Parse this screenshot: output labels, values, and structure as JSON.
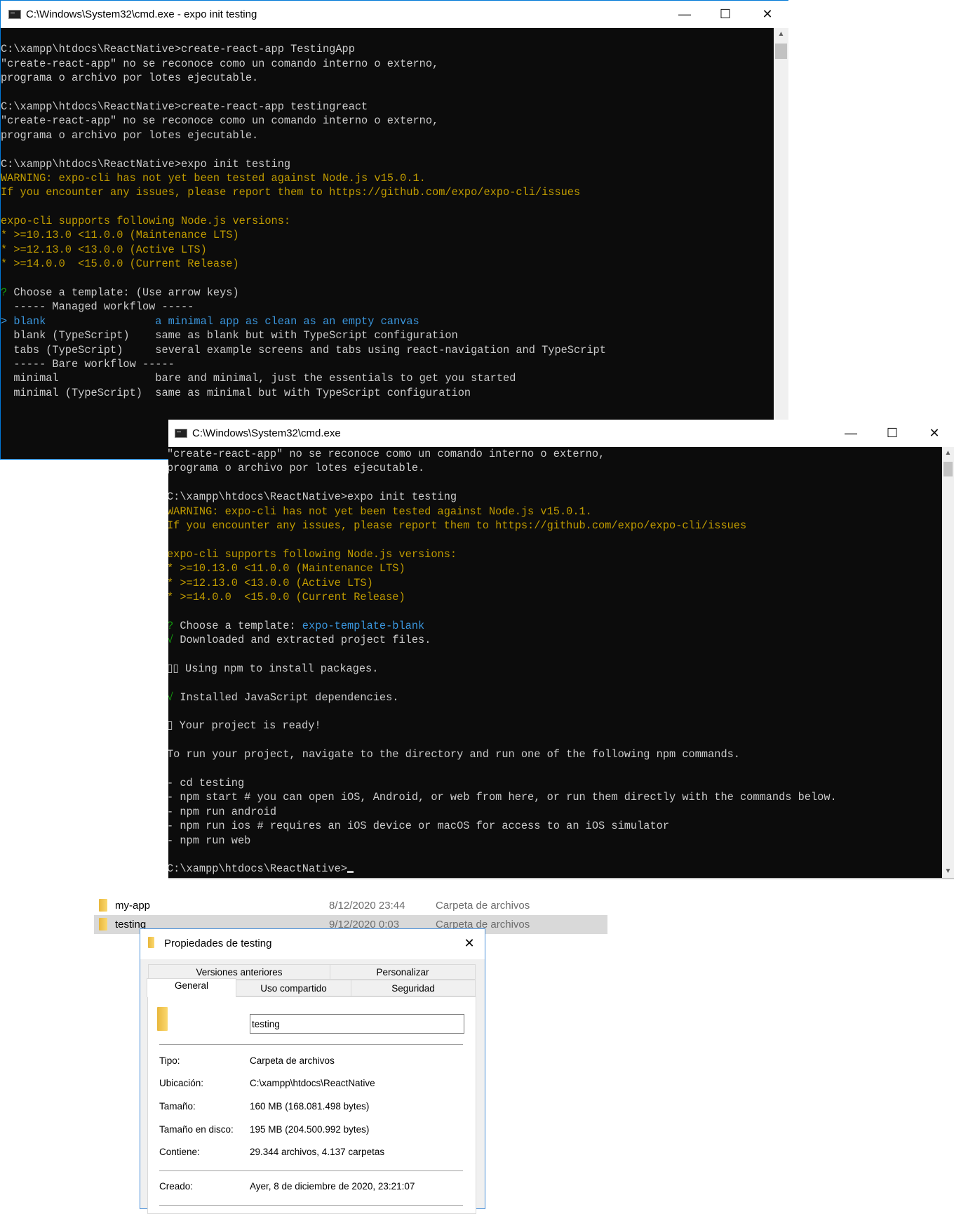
{
  "colors": {
    "default": "#cccccc",
    "yellow": "#c19c00",
    "blue": "#3a96dd",
    "green": "#13a10e",
    "background": "#0c0c0c"
  },
  "terminal1": {
    "title": "C:\\Windows\\System32\\cmd.exe - expo  init testing",
    "icon": "cmd-icon",
    "lines": [
      [],
      [
        {
          "t": "C:\\xampp\\htdocs\\ReactNative>create-react-app TestingApp",
          "c": "default"
        }
      ],
      [
        {
          "t": "\"create-react-app\" no se reconoce como un comando interno o externo,",
          "c": "default"
        }
      ],
      [
        {
          "t": "programa o archivo por lotes ejecutable.",
          "c": "default"
        }
      ],
      [],
      [
        {
          "t": "C:\\xampp\\htdocs\\ReactNative>create-react-app testingreact",
          "c": "default"
        }
      ],
      [
        {
          "t": "\"create-react-app\" no se reconoce como un comando interno o externo,",
          "c": "default"
        }
      ],
      [
        {
          "t": "programa o archivo por lotes ejecutable.",
          "c": "default"
        }
      ],
      [],
      [
        {
          "t": "C:\\xampp\\htdocs\\ReactNative>expo init testing",
          "c": "default"
        }
      ],
      [
        {
          "t": "WARNING: expo-cli has not yet been tested against Node.js v15.0.1.",
          "c": "yellow"
        }
      ],
      [
        {
          "t": "If you encounter any issues, please report them to https://github.com/expo/expo-cli/issues",
          "c": "yellow"
        }
      ],
      [],
      [
        {
          "t": "expo-cli supports following Node.js versions:",
          "c": "yellow"
        }
      ],
      [
        {
          "t": "* >=10.13.0 <11.0.0 (Maintenance LTS)",
          "c": "yellow"
        }
      ],
      [
        {
          "t": "* >=12.13.0 <13.0.0 (Active LTS)",
          "c": "yellow"
        }
      ],
      [
        {
          "t": "* >=14.0.0  <15.0.0 (Current Release)",
          "c": "yellow"
        }
      ],
      [],
      [
        {
          "t": "?",
          "c": "green"
        },
        {
          "t": " Choose a template: (Use arrow keys)",
          "c": "default"
        }
      ],
      [
        {
          "t": "  ----- Managed workflow -----",
          "c": "default"
        }
      ],
      [
        {
          "t": "> blank                 a minimal app as clean as an empty canvas",
          "c": "blue"
        }
      ],
      [
        {
          "t": "  blank (TypeScript)    same as blank but with TypeScript configuration",
          "c": "default"
        }
      ],
      [
        {
          "t": "  tabs (TypeScript)     several example screens and tabs using react-navigation and TypeScript",
          "c": "default"
        }
      ],
      [
        {
          "t": "  ----- Bare workflow -----",
          "c": "default"
        }
      ],
      [
        {
          "t": "  minimal               bare and minimal, just the essentials to get you started",
          "c": "default"
        }
      ],
      [
        {
          "t": "  minimal (TypeScript)  same as minimal but with TypeScript configuration",
          "c": "default"
        }
      ]
    ]
  },
  "terminal2": {
    "title": "C:\\Windows\\System32\\cmd.exe",
    "icon": "cmd-icon",
    "lines": [
      [
        {
          "t": "\"create-react-app\" no se reconoce como un comando interno o externo,",
          "c": "default"
        }
      ],
      [
        {
          "t": "programa o archivo por lotes ejecutable.",
          "c": "default"
        }
      ],
      [],
      [
        {
          "t": "C:\\xampp\\htdocs\\ReactNative>expo init testing",
          "c": "default"
        }
      ],
      [
        {
          "t": "WARNING: expo-cli has not yet been tested against Node.js v15.0.1.",
          "c": "yellow"
        }
      ],
      [
        {
          "t": "If you encounter any issues, please report them to https://github.com/expo/expo-cli/issues",
          "c": "yellow"
        }
      ],
      [],
      [
        {
          "t": "expo-cli supports following Node.js versions:",
          "c": "yellow"
        }
      ],
      [
        {
          "t": "* >=10.13.0 <11.0.0 (Maintenance LTS)",
          "c": "yellow"
        }
      ],
      [
        {
          "t": "* >=12.13.0 <13.0.0 (Active LTS)",
          "c": "yellow"
        }
      ],
      [
        {
          "t": "* >=14.0.0  <15.0.0 (Current Release)",
          "c": "yellow"
        }
      ],
      [],
      [
        {
          "t": "?",
          "c": "green"
        },
        {
          "t": " Choose a template: ",
          "c": "default"
        },
        {
          "t": "expo-template-blank",
          "c": "blue"
        }
      ],
      [
        {
          "t": "√",
          "c": "green"
        },
        {
          "t": " Downloaded and extracted project files.",
          "c": "default"
        }
      ],
      [],
      [
        {
          "t": "▯▯ Using npm to install packages.",
          "c": "default"
        }
      ],
      [],
      [
        {
          "t": "√",
          "c": "green"
        },
        {
          "t": " Installed JavaScript dependencies.",
          "c": "default"
        }
      ],
      [],
      [
        {
          "t": "▯ Your project is ready!",
          "c": "default"
        }
      ],
      [],
      [
        {
          "t": "To run your project, navigate to the directory and run one of the following npm commands.",
          "c": "default"
        }
      ],
      [],
      [
        {
          "t": "- cd testing",
          "c": "default"
        }
      ],
      [
        {
          "t": "- npm start # you can open iOS, Android, or web from here, or run them directly with the commands below.",
          "c": "default"
        }
      ],
      [
        {
          "t": "- npm run android",
          "c": "default"
        }
      ],
      [
        {
          "t": "- npm run ios # requires an iOS device or macOS for access to an iOS simulator",
          "c": "default"
        }
      ],
      [
        {
          "t": "- npm run web",
          "c": "default"
        }
      ],
      [],
      [
        {
          "t": "C:\\xampp\\htdocs\\ReactNative>",
          "c": "default"
        }
      ]
    ]
  },
  "explorer": {
    "rows": [
      {
        "name": "my-app",
        "date": "8/12/2020 23:44",
        "type": "Carpeta de archivos",
        "selected": false
      },
      {
        "name": "testing",
        "date": "9/12/2020 0:03",
        "type": "Carpeta de archivos",
        "selected": true
      }
    ]
  },
  "dialog": {
    "title": "Propiedades de testing",
    "tabs_row1": [
      "Versiones anteriores",
      "Personalizar"
    ],
    "tabs_row2": [
      "General",
      "Uso compartido",
      "Seguridad"
    ],
    "active_tab": "General",
    "name_value": "testing",
    "props": [
      {
        "label": "Tipo:",
        "value": "Carpeta de archivos"
      },
      {
        "label": "Ubicación:",
        "value": "C:\\xampp\\htdocs\\ReactNative"
      },
      {
        "label": "Tamaño:",
        "value": "160 MB (168.081.498 bytes)"
      },
      {
        "label": "Tamaño en disco:",
        "value": "195 MB (204.500.992 bytes)"
      },
      {
        "label": "Contiene:",
        "value": "29.344 archivos, 4.137 carpetas"
      },
      {
        "label": "Creado:",
        "value": "Ayer, 8 de diciembre de 2020, 23:21:07"
      }
    ]
  }
}
